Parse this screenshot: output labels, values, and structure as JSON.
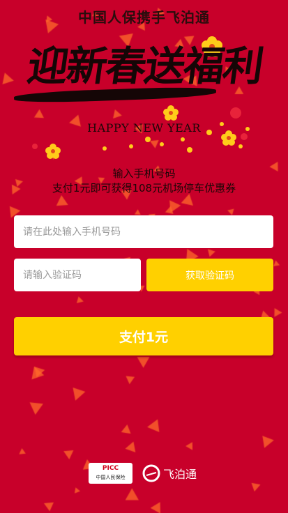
{
  "header": {
    "title": "中国人保携手飞泊通"
  },
  "hero": {
    "headline": "迎新春送福利",
    "subtitle": "HAPPY NEW YEAR"
  },
  "intro": {
    "line1": "输入手机号码",
    "line2": "支付1元即可获得108元机场停车优惠券"
  },
  "form": {
    "phone_placeholder": "请在此处输入手机号码",
    "code_placeholder": "请输入验证码",
    "get_code_label": "获取验证码",
    "pay_label": "支付1元"
  },
  "footer": {
    "picc_mark": "PICC",
    "picc_name": "中国人民保险",
    "partner_name": "飞泊通"
  },
  "colors": {
    "background": "#c8002a",
    "accent_yellow": "#ffd000",
    "confetti": "#ff6a2b"
  },
  "icons": {
    "blossom": "plum-blossom-icon",
    "partner_logo": "feibotong-logo-icon"
  }
}
